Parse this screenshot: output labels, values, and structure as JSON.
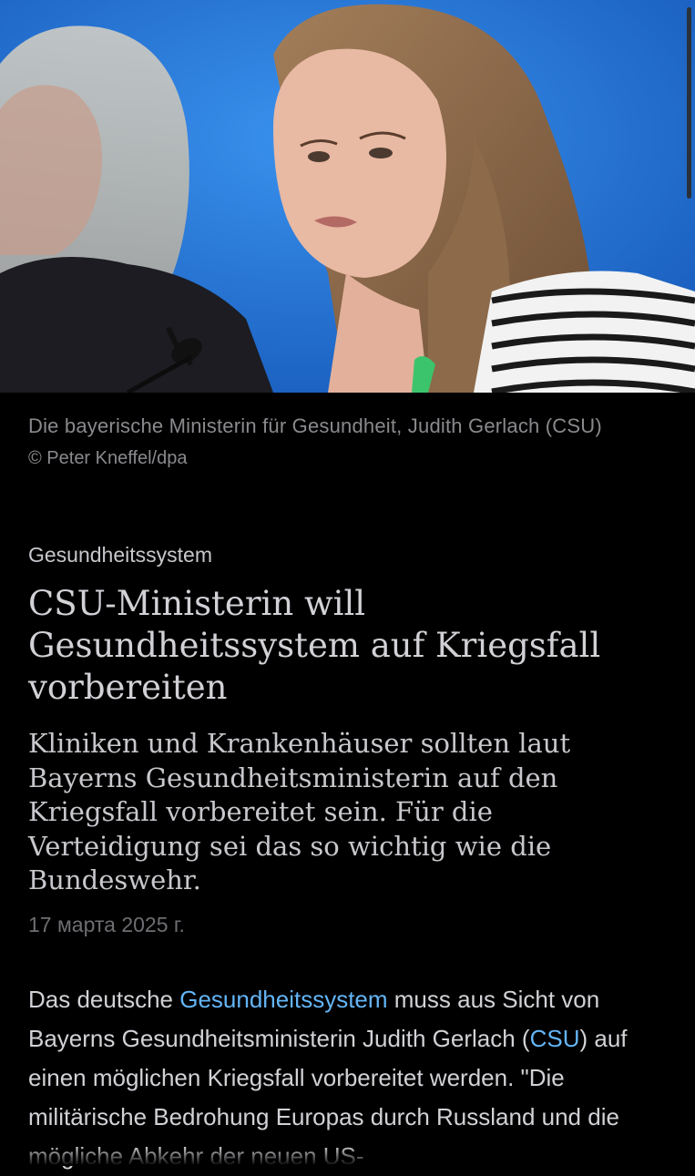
{
  "photo": {
    "caption": "Die bayerische Ministerin für Gesundheit, Judith Gerlach (CSU)",
    "credit": "© Peter Kneffel/dpa",
    "colors": {
      "background": "#1e73d6"
    }
  },
  "article": {
    "kicker": "Gesundheitssystem",
    "headline": "CSU-Ministerin will Gesundheitssystem auf Kriegsfall vorbereiten",
    "lead": "Kliniken und Krankenhäuser sollten laut Bayerns Gesundheitsministerin auf den Kriegsfall vorbereitet sein. Für die Verteidigung sei das so wichtig wie die Bundeswehr.",
    "date": "17 марта 2025 г.",
    "body": {
      "part1": "Das deutsche ",
      "link1": "Gesundheitssystem",
      "part2": " muss aus Sicht von Bayerns Gesundheitsministerin Judith Gerlach (",
      "link2": "CSU",
      "part3": ") auf einen möglichen Kriegsfall vorbereitet werden. \"Die militärische Bedrohung Europas durch Russland und die mögliche Abkehr der neuen US-"
    },
    "colors": {
      "link": "#64b5f6",
      "background": "#000000"
    }
  }
}
